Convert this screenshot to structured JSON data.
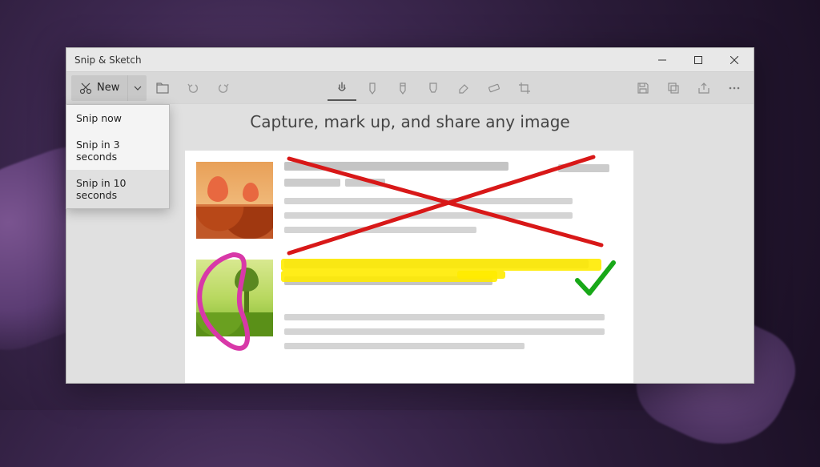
{
  "window": {
    "title": "Snip & Sketch"
  },
  "toolbar": {
    "new_label": "New"
  },
  "dropdown": {
    "items": [
      {
        "label": "Snip now"
      },
      {
        "label": "Snip in 3 seconds"
      },
      {
        "label": "Snip in 10 seconds"
      }
    ]
  },
  "canvas": {
    "heading": "Capture, mark up, and share any image"
  },
  "colors": {
    "cross": "#d81818",
    "heart": "#d838a8",
    "highlight": "#ffeb00",
    "check": "#18a818"
  }
}
